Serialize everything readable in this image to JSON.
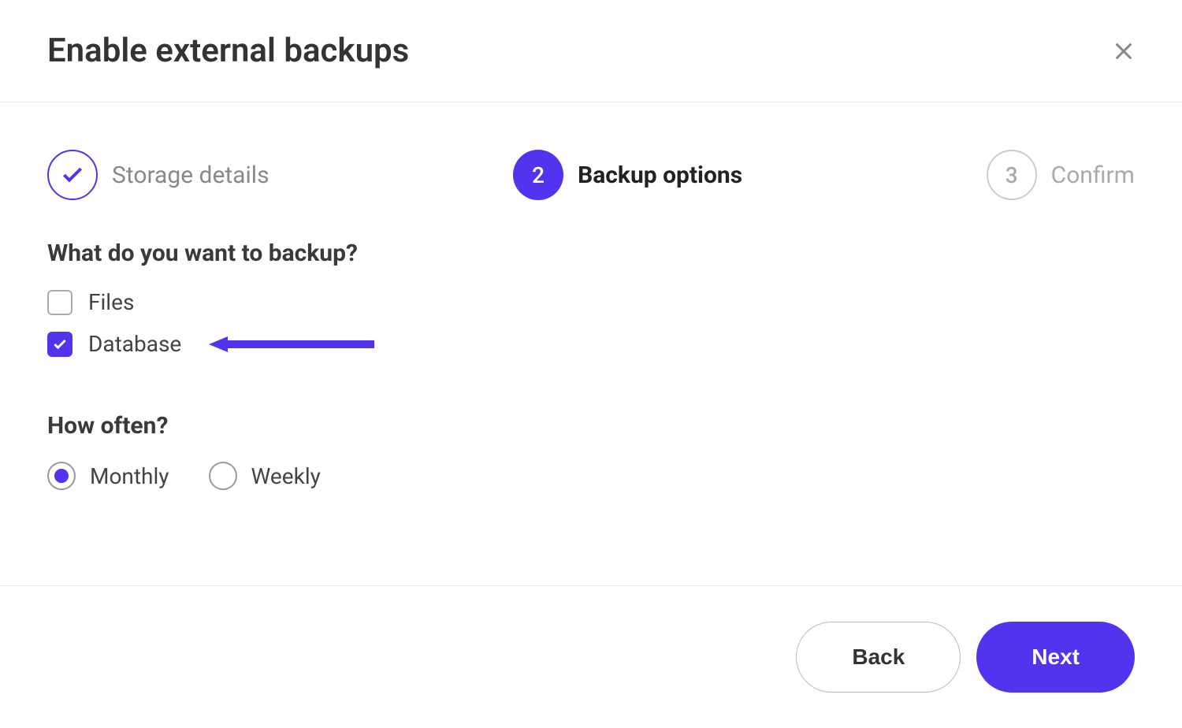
{
  "header": {
    "title": "Enable external backups"
  },
  "stepper": {
    "step1": {
      "label": "Storage details"
    },
    "step2": {
      "number": "2",
      "label": "Backup options"
    },
    "step3": {
      "number": "3",
      "label": "Confirm"
    }
  },
  "content": {
    "q1": "What do you want to backup?",
    "opt1": "Files",
    "opt2": "Database",
    "q2": "How often?",
    "freq1": "Monthly",
    "freq2": "Weekly"
  },
  "footer": {
    "back": "Back",
    "next": "Next"
  }
}
